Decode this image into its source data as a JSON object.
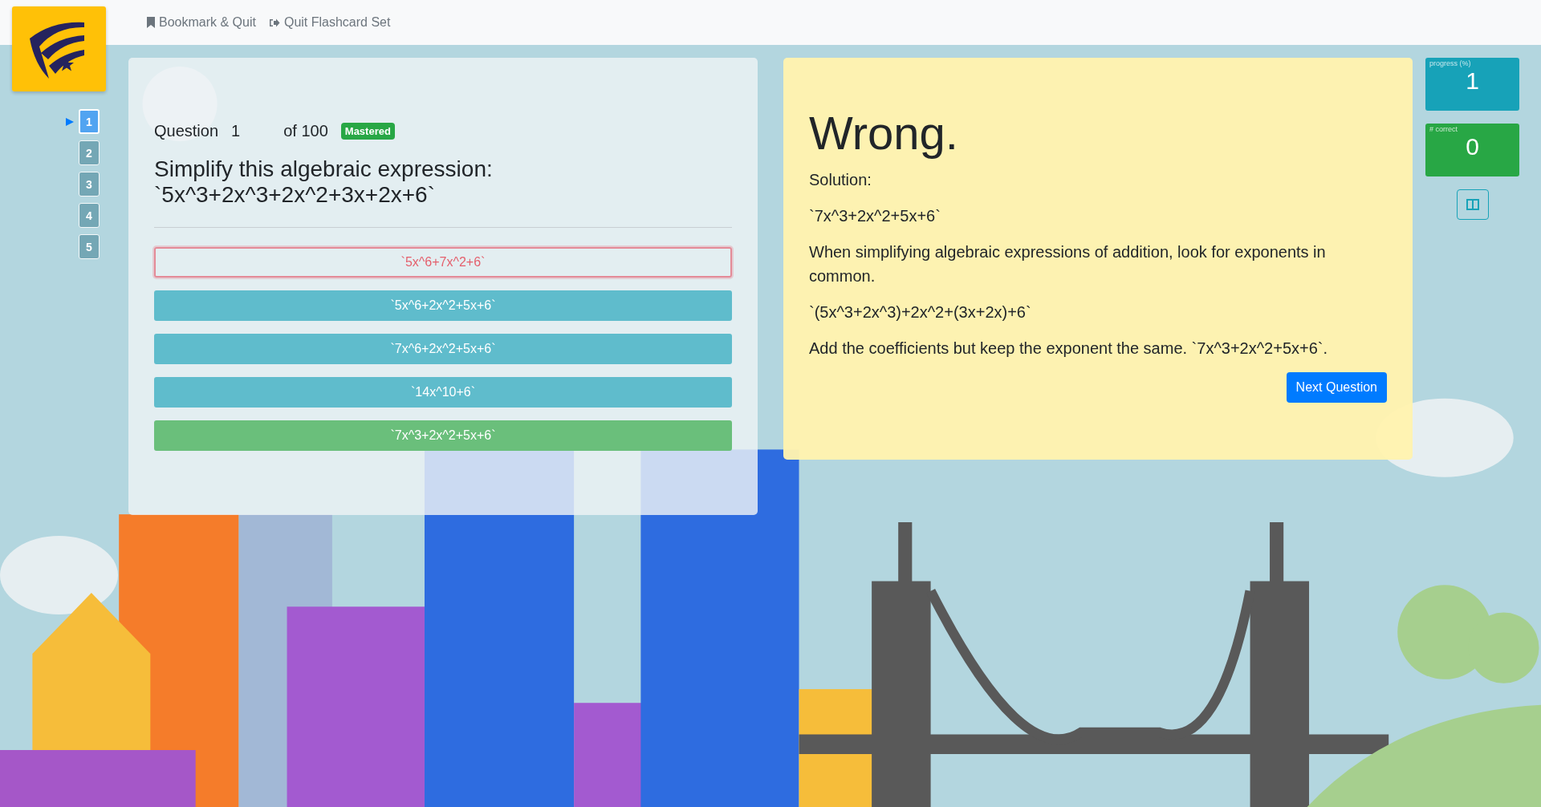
{
  "toolbar": {
    "links": [
      {
        "label": "Bookmark & Quit",
        "kind": "bookmark"
      },
      {
        "label": "Quit Flashcard Set",
        "kind": "quit"
      }
    ]
  },
  "question_nav": {
    "items": [
      {
        "label": "1",
        "selected": true
      },
      {
        "label": "2",
        "selected": false
      },
      {
        "label": "3",
        "selected": false
      },
      {
        "label": "4",
        "selected": false
      },
      {
        "label": "5",
        "selected": false
      }
    ]
  },
  "question": {
    "label": "Question",
    "number": "1",
    "total": "of 100",
    "badge": "Mastered",
    "prompt": "Simplify this algebraic expression:",
    "expression": "`5x^3+2x^3+2x^2+3x+2x+6`",
    "answers": [
      {
        "text": "`5x^6+7x^2+6`",
        "kind": "wrong"
      },
      {
        "text": "`5x^6+2x^2+5x+6`",
        "kind": "option"
      },
      {
        "text": "`7x^6+2x^2+5x+6`",
        "kind": "option"
      },
      {
        "text": "`14x^10+6`",
        "kind": "option"
      },
      {
        "text": "`7x^3+2x^2+5x+6`",
        "kind": "correct"
      }
    ]
  },
  "feedback": {
    "verdict": "Wrong.",
    "solution_label": "Solution:",
    "paragraphs": [
      "`7x^3+2x^2+5x+6`",
      "When simplifying algebraic expressions of addition, look for exponents in common.",
      "`(5x^3+2x^3)+2x^2+(3x+2x)+6`",
      "Add the coefficients but keep the exponent the same. `7x^3+2x^2+5x+6`."
    ],
    "button": "Next Question"
  },
  "stats": [
    {
      "label": "progress (%)",
      "value": "1",
      "color": "#17a2b8"
    },
    {
      "label": "# correct",
      "value": "0",
      "color": "#28a745"
    }
  ]
}
